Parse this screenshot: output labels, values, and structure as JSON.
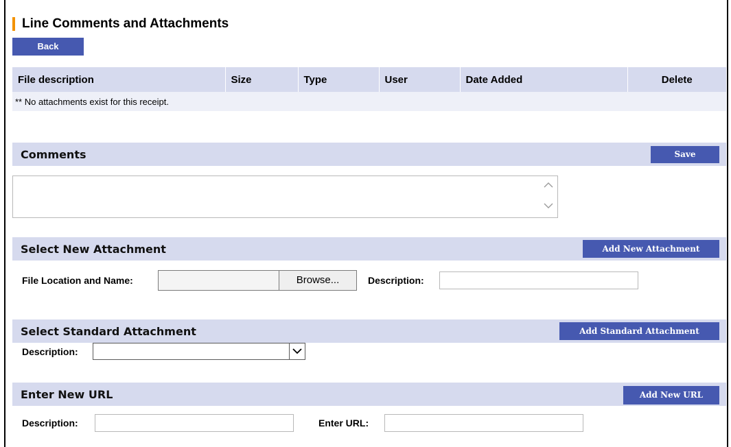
{
  "page_title": "Line Comments and Attachments",
  "back_label": "Back",
  "accent_color": "#f39200",
  "button_color": "#4659b0",
  "attachments_table": {
    "columns": [
      "File description",
      "Size",
      "Type",
      "User",
      "Date Added",
      "Delete"
    ],
    "empty_message": "** No attachments exist for this receipt."
  },
  "comments": {
    "title": "Comments",
    "save_label": "Save",
    "value": ""
  },
  "new_attachment": {
    "title": "Select New Attachment",
    "add_label": "Add New Attachment",
    "file_label": "File Location and Name:",
    "file_value": "",
    "browse_label": "Browse...",
    "description_label": "Description:",
    "description_value": ""
  },
  "standard_attachment": {
    "title": "Select Standard Attachment",
    "add_label": "Add Standard Attachment",
    "description_label": "Description:",
    "selected": ""
  },
  "new_url": {
    "title": "Enter New URL",
    "add_label": "Add New URL",
    "description_label": "Description:",
    "description_value": "",
    "url_label": "Enter URL:",
    "url_value": ""
  },
  "icons": {
    "scroll_up": "chevron-up-icon",
    "scroll_down": "chevron-down-icon",
    "select_arrow": "chevron-down-icon"
  }
}
